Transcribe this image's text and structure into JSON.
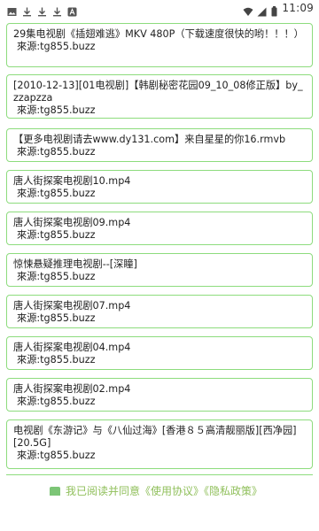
{
  "status_bar": {
    "time": "11:09",
    "left_icons": [
      "image-icon",
      "download-icon",
      "download-icon",
      "download-icon",
      "a-badge-icon"
    ],
    "right_icons": [
      "wifi-icon",
      "signal-icon",
      "battery-icon"
    ]
  },
  "items": [
    {
      "title": "29集电视剧《插翅难逃》MKV 480P（下载速度很快的哟！！！）",
      "source": "來源:tg855.buzz"
    },
    {
      "title": "[2010-12-13][01电视剧]【韩剧秘密花园09_10_08修正版】by_zzapzza",
      "source": "來源:tg855.buzz"
    },
    {
      "title": "【更多电视剧请去www.dy131.com】来自星星的你16.rmvb",
      "source": "來源:tg855.buzz"
    },
    {
      "title": "唐人街探案电视剧10.mp4",
      "source": "來源:tg855.buzz"
    },
    {
      "title": "唐人街探案电视剧09.mp4",
      "source": "來源:tg855.buzz"
    },
    {
      "title": "惊悚悬疑推理电视剧--[深瞳]",
      "source": "來源:tg855.buzz"
    },
    {
      "title": "唐人街探案电视剧07.mp4",
      "source": "來源:tg855.buzz"
    },
    {
      "title": "唐人街探案电视剧04.mp4",
      "source": "來源:tg855.buzz"
    },
    {
      "title": "唐人街探案电视剧02.mp4",
      "source": "來源:tg855.buzz"
    },
    {
      "title": "电视剧《东游记》与《八仙过海》[香港８５高清靓丽版][西净园][20.5G]",
      "source": "來源:tg855.buzz"
    }
  ],
  "agreement": {
    "text": "我已阅读并同意《使用协议》《隐私政策》"
  },
  "colors": {
    "card_border": "#8ddc7d",
    "checkbox": "#7cc576",
    "agreement_text": "#8fbf5a"
  }
}
